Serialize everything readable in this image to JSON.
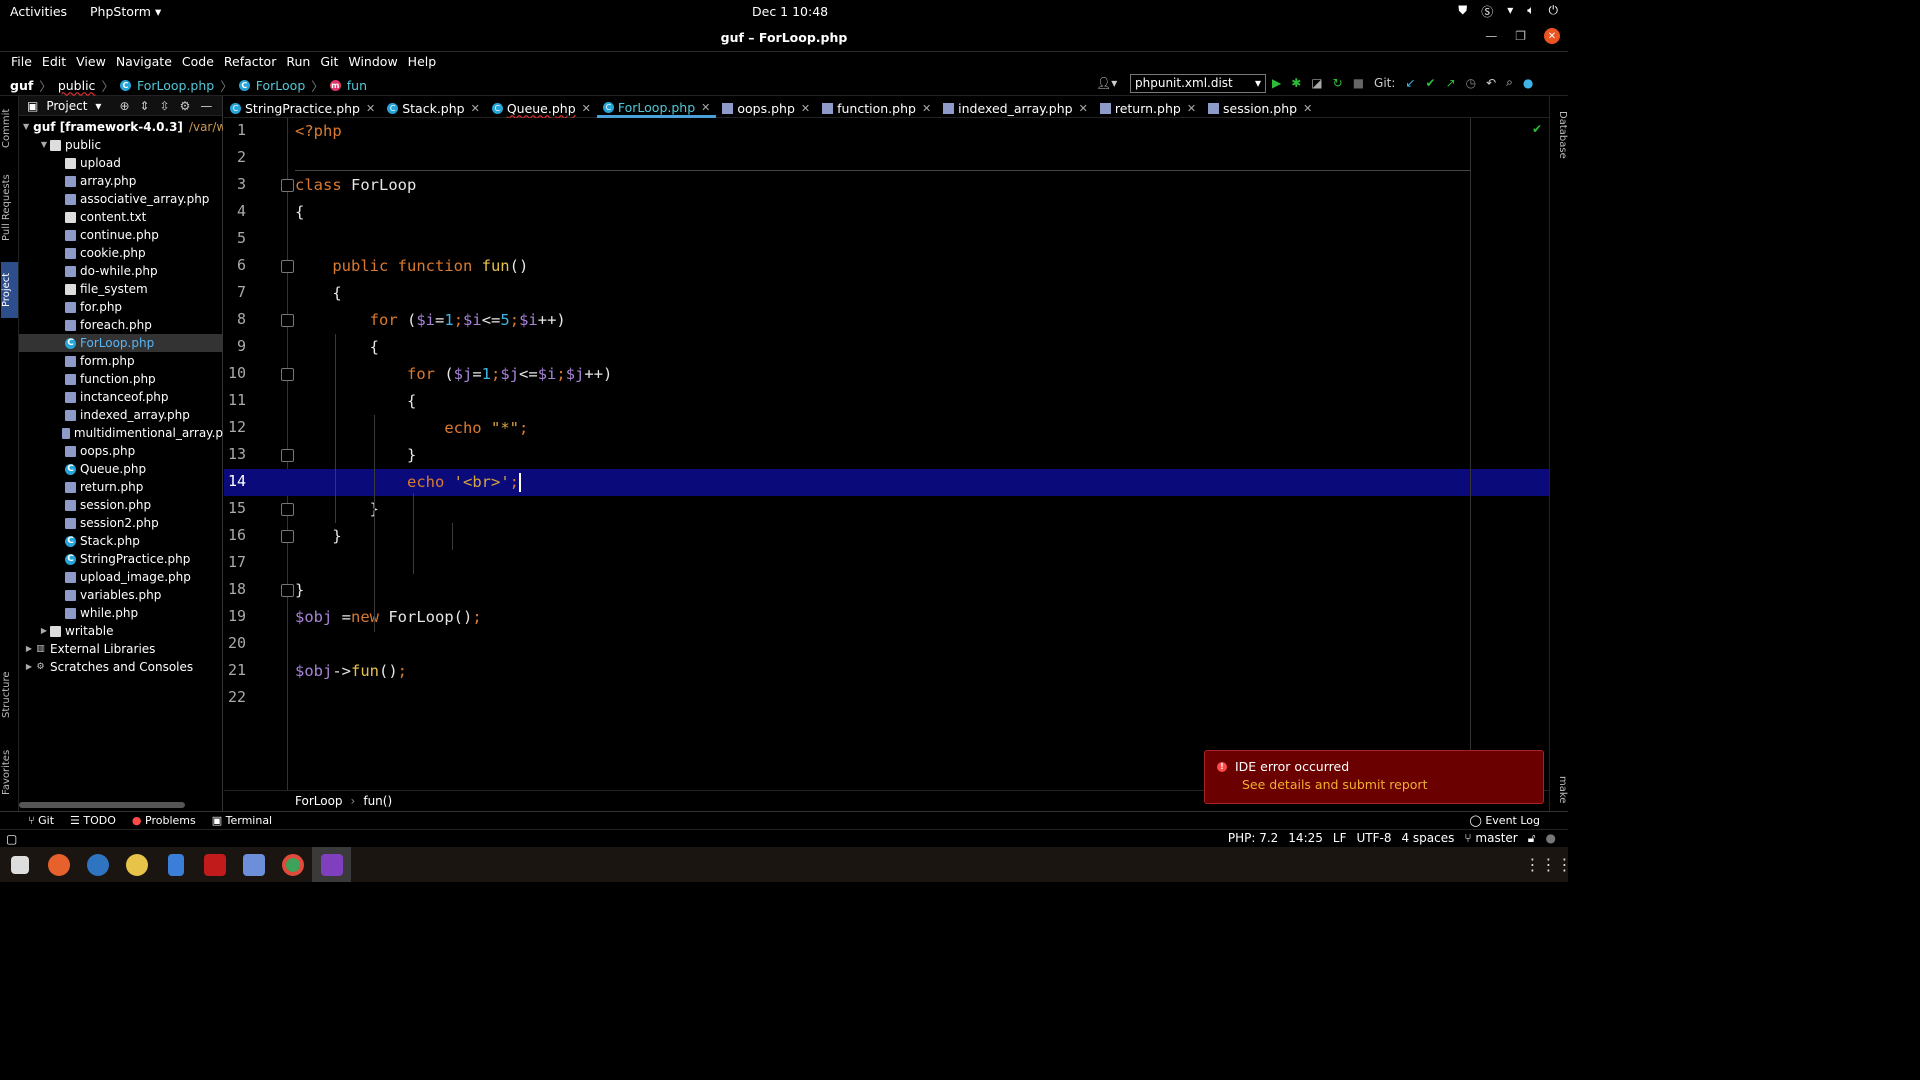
{
  "system": {
    "activities": "Activities",
    "app_name": "PhpStorm",
    "clock": "Dec 1  10:48"
  },
  "window": {
    "title": "guf – ForLoop.php"
  },
  "menu": [
    "File",
    "Edit",
    "View",
    "Navigate",
    "Code",
    "Refactor",
    "Run",
    "Git",
    "Window",
    "Help"
  ],
  "breadcrumb": [
    "guf",
    "public",
    "ForLoop.php",
    "ForLoop",
    "fun"
  ],
  "toolbar": {
    "run_config": "phpunit.xml.dist",
    "git_label": "Git:"
  },
  "left_strip": [
    "Commit",
    "Pull Requests",
    "Project",
    "Structure",
    "Favorites"
  ],
  "right_strip": [
    "Database",
    "make"
  ],
  "project_panel": {
    "title": "Project",
    "root_label": "guf [framework-4.0.3]",
    "root_path": "/var/w",
    "tree": [
      {
        "label": "public",
        "kind": "folder",
        "depth": 1,
        "open": true
      },
      {
        "label": "upload",
        "kind": "folder",
        "depth": 2
      },
      {
        "label": "array.php",
        "kind": "php",
        "depth": 2
      },
      {
        "label": "associative_array.php",
        "kind": "php",
        "depth": 2
      },
      {
        "label": "content.txt",
        "kind": "txt",
        "depth": 2
      },
      {
        "label": "continue.php",
        "kind": "php",
        "depth": 2
      },
      {
        "label": "cookie.php",
        "kind": "php",
        "depth": 2
      },
      {
        "label": "do-while.php",
        "kind": "php",
        "depth": 2
      },
      {
        "label": "file_system",
        "kind": "txt",
        "depth": 2
      },
      {
        "label": "for.php",
        "kind": "php",
        "depth": 2
      },
      {
        "label": "foreach.php",
        "kind": "php",
        "depth": 2
      },
      {
        "label": "ForLoop.php",
        "kind": "cls",
        "depth": 2,
        "selected": true
      },
      {
        "label": "form.php",
        "kind": "php",
        "depth": 2
      },
      {
        "label": "function.php",
        "kind": "php",
        "depth": 2
      },
      {
        "label": "inctanceof.php",
        "kind": "php",
        "depth": 2
      },
      {
        "label": "indexed_array.php",
        "kind": "php",
        "depth": 2
      },
      {
        "label": "multidimentional_array.p",
        "kind": "php",
        "depth": 2
      },
      {
        "label": "oops.php",
        "kind": "php",
        "depth": 2
      },
      {
        "label": "Queue.php",
        "kind": "cls",
        "depth": 2
      },
      {
        "label": "return.php",
        "kind": "php",
        "depth": 2
      },
      {
        "label": "session.php",
        "kind": "php",
        "depth": 2
      },
      {
        "label": "session2.php",
        "kind": "php",
        "depth": 2
      },
      {
        "label": "Stack.php",
        "kind": "cls",
        "depth": 2
      },
      {
        "label": "StringPractice.php",
        "kind": "cls",
        "depth": 2
      },
      {
        "label": "upload_image.php",
        "kind": "php",
        "depth": 2
      },
      {
        "label": "variables.php",
        "kind": "php",
        "depth": 2
      },
      {
        "label": "while.php",
        "kind": "php",
        "depth": 2
      },
      {
        "label": "writable",
        "kind": "folder",
        "depth": 1,
        "open": false
      },
      {
        "label": "External Libraries",
        "kind": "lib",
        "depth": 0,
        "open": false
      },
      {
        "label": "Scratches and Consoles",
        "kind": "lib",
        "depth": 0,
        "open": false
      }
    ]
  },
  "tabs": [
    {
      "label": "StringPractice.php",
      "kind": "cls"
    },
    {
      "label": "Stack.php",
      "kind": "cls"
    },
    {
      "label": "Queue.php",
      "kind": "cls",
      "error": true
    },
    {
      "label": "ForLoop.php",
      "kind": "cls",
      "active": true
    },
    {
      "label": "oops.php",
      "kind": "php"
    },
    {
      "label": "function.php",
      "kind": "php"
    },
    {
      "label": "indexed_array.php",
      "kind": "php"
    },
    {
      "label": "return.php",
      "kind": "php"
    },
    {
      "label": "session.php",
      "kind": "php"
    }
  ],
  "code_lines": [
    [
      [
        "tag",
        "<?php"
      ]
    ],
    [],
    [
      [
        "kw",
        "class "
      ],
      [
        "pl",
        "ForLoop"
      ]
    ],
    [
      [
        "pl",
        "{"
      ]
    ],
    [],
    [
      [
        "pl",
        "    "
      ],
      [
        "kw",
        "public function "
      ],
      [
        "fn",
        "fun"
      ],
      [
        "pl",
        "()"
      ]
    ],
    [
      [
        "pl",
        "    {"
      ]
    ],
    [
      [
        "pl",
        "        "
      ],
      [
        "kw",
        "for "
      ],
      [
        "pl",
        "("
      ],
      [
        "var",
        "$i"
      ],
      [
        "pl",
        "="
      ],
      [
        "num",
        "1"
      ],
      [
        "kw",
        ";"
      ],
      [
        "var",
        "$i"
      ],
      [
        "pl",
        "<="
      ],
      [
        "num",
        "5"
      ],
      [
        "kw",
        ";"
      ],
      [
        "var",
        "$i"
      ],
      [
        "pl",
        "++)"
      ]
    ],
    [
      [
        "pl",
        "        {"
      ]
    ],
    [
      [
        "pl",
        "            "
      ],
      [
        "kw",
        "for "
      ],
      [
        "pl",
        "("
      ],
      [
        "var",
        "$j"
      ],
      [
        "pl",
        "="
      ],
      [
        "num",
        "1"
      ],
      [
        "kw",
        ";"
      ],
      [
        "var",
        "$j"
      ],
      [
        "pl",
        "<="
      ],
      [
        "var",
        "$i"
      ],
      [
        "kw",
        ";"
      ],
      [
        "var",
        "$j"
      ],
      [
        "pl",
        "++)"
      ]
    ],
    [
      [
        "pl",
        "            {"
      ]
    ],
    [
      [
        "pl",
        "                "
      ],
      [
        "kw",
        "echo "
      ],
      [
        "str",
        "\"*\""
      ],
      [
        "kw",
        ";"
      ]
    ],
    [
      [
        "pl",
        "            }"
      ]
    ],
    [
      [
        "pl",
        "            "
      ],
      [
        "kw",
        "echo "
      ],
      [
        "str",
        "'<br>'"
      ],
      [
        "kw",
        ";"
      ]
    ],
    [
      [
        "pl",
        "        }"
      ]
    ],
    [
      [
        "pl",
        "    }"
      ]
    ],
    [],
    [
      [
        "pl",
        "}"
      ]
    ],
    [
      [
        "var",
        "$obj "
      ],
      [
        "pl",
        "="
      ],
      [
        "kw",
        "new "
      ],
      [
        "pl",
        "ForLoop()"
      ],
      [
        "kw",
        ";"
      ]
    ],
    [],
    [
      [
        "var",
        "$obj"
      ],
      [
        "pl",
        "->"
      ],
      [
        "fn",
        "fun"
      ],
      [
        "pl",
        "()"
      ],
      [
        "kw",
        ";"
      ]
    ],
    []
  ],
  "editor": {
    "current_line": 14,
    "breadcrumb": [
      "ForLoop",
      "fun()"
    ]
  },
  "notification": {
    "title": "IDE error occurred",
    "link": "See details and submit report"
  },
  "bottom_tools": [
    "Git",
    "TODO",
    "Problems",
    "Terminal"
  ],
  "event_log": "Event Log",
  "status": {
    "php": "PHP: 7.2",
    "position": "14:25",
    "line_sep": "LF",
    "encoding": "UTF-8",
    "indent": "4 spaces",
    "branch": "master"
  },
  "colors": {
    "keyword": "#d97a30",
    "function": "#e8c34a",
    "variable": "#a784d6",
    "number": "#3fb5e6",
    "string": "#d7a640",
    "current_line": "#0a0a7a",
    "error_bg": "#6a0000",
    "link": "#f0b030"
  }
}
